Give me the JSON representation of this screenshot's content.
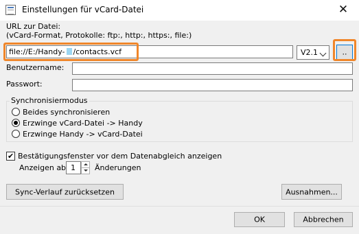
{
  "window": {
    "title": "Einstellungen für vCard-Datei",
    "close_glyph": "✕"
  },
  "url": {
    "label_line1": "URL zur Datei:",
    "label_line2": "(vCard-Format, Protokolle: ftp:, http:, https:, file:)",
    "value_prefix": "file://E:/Handy-",
    "value_suffix": "/contacts.vcf",
    "version": "V2.1",
    "browse_label": ".."
  },
  "credentials": {
    "username_label": "Benutzername:",
    "username_value": "",
    "password_label": "Passwort:",
    "password_value": ""
  },
  "sync_mode": {
    "title": "Synchronisiermodus",
    "options": [
      {
        "label": "Beides synchronisieren",
        "checked": false
      },
      {
        "label": "Erzwinge vCard-Datei -> Handy",
        "checked": true
      },
      {
        "label": "Erzwinge Handy -> vCard-Datei",
        "checked": false
      }
    ]
  },
  "confirm": {
    "checkbox_label": "Bestätigungsfenster vor dem Datenabgleich anzeigen",
    "checked": true,
    "check_glyph": "✔",
    "show_from_label": "Anzeigen ab",
    "changes_value": "1",
    "changes_label": "Änderungen"
  },
  "buttons": {
    "reset_history": "Sync-Verlauf zurücksetzen",
    "exceptions": "Ausnahmen...",
    "ok": "OK",
    "cancel": "Abbrechen"
  },
  "colors": {
    "highlight": "#f0862a",
    "dialog_bg": "#f0f0f0",
    "focus_blue": "#0078d7"
  }
}
